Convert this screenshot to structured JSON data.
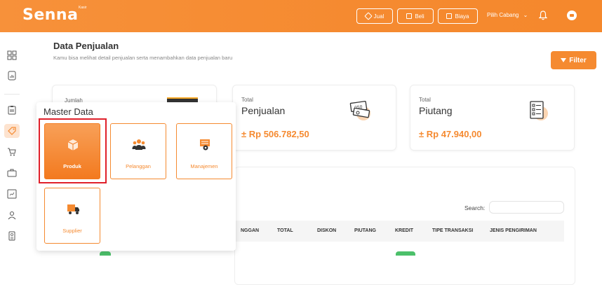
{
  "app": {
    "logo": "Senna",
    "logo_sup": "Kasir"
  },
  "topbar": {
    "jual_label": "Jual",
    "beli_label": "Beli",
    "biaya_label": "Biaya",
    "branch_label": "Pilih Cabang"
  },
  "header": {
    "title": "Data Penjualan",
    "subtitle": "Kamu bisa melihat detail penjualan serta menambahkan data penjualan baru",
    "filter_label": "Filter"
  },
  "cards": [
    {
      "label": "Jumlah",
      "title": "",
      "value": ""
    },
    {
      "label": "Total",
      "title": "Penjualan",
      "value": "± Rp 506.782,50"
    },
    {
      "label": "Total",
      "title": "Piutang",
      "value": "± Rp 47.940,00"
    }
  ],
  "table": {
    "search_label": "Search:",
    "search_value": "",
    "columns": [
      "NGGAN",
      "TOTAL",
      "DISKON",
      "PIUTANG",
      "KREDIT",
      "TIPE TRANSAKSI",
      "JENIS PENGIRIMAN"
    ]
  },
  "master_data": {
    "title": "Master Data",
    "items": [
      {
        "label": "Produk",
        "icon": "box-icon",
        "active": true
      },
      {
        "label": "Pelanggan",
        "icon": "people-icon",
        "active": false
      },
      {
        "label": "Manajemen",
        "icon": "manajemen-icon",
        "active": false
      },
      {
        "label": "Supplier",
        "icon": "truck-icon",
        "active": false
      }
    ]
  },
  "colors": {
    "brand_orange": "#f58a30",
    "highlight_red": "#e0202a",
    "chip_green": "#4cc06a"
  }
}
